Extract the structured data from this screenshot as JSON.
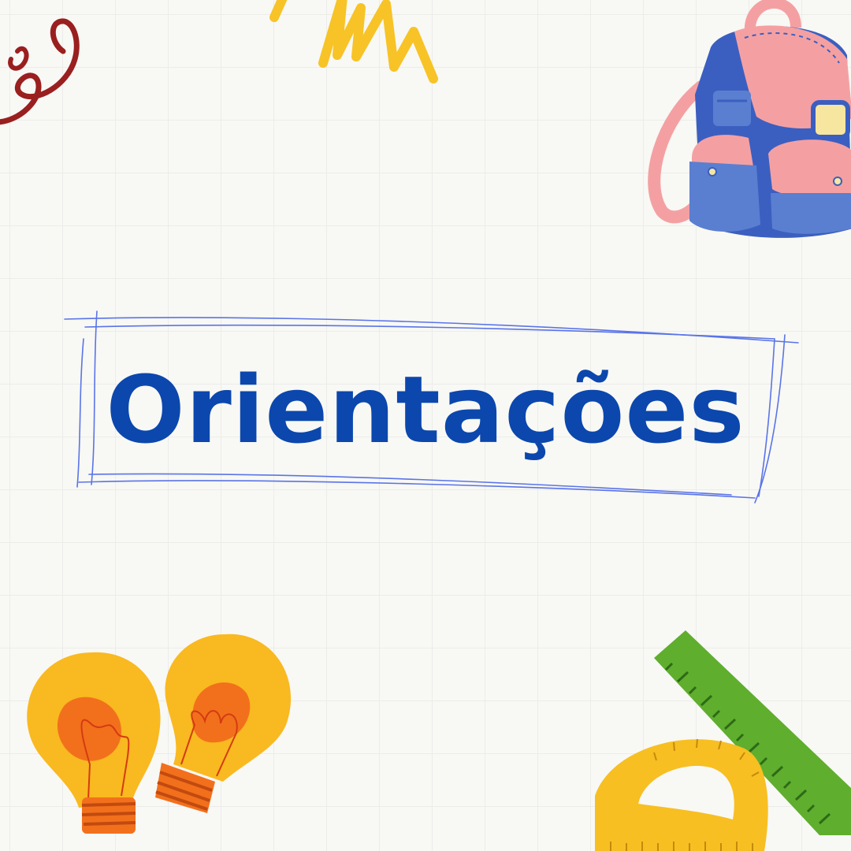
{
  "title": "Orientações",
  "colors": {
    "background": "#f8f8f5",
    "grid": "#ececea",
    "title": "#0b47ad",
    "frame": "#5a74e8",
    "scribble_red": "#9a1f1f",
    "scribble_yellow": "#f7c326",
    "backpack_blue": "#3b5fc0",
    "backpack_pink": "#f4a0a2",
    "bulb_yellow": "#f9b920",
    "bulb_orange": "#f2701c",
    "ruler_green": "#5fae2e",
    "protractor_yellow": "#f7bf22"
  },
  "icons": [
    "red-scribble-icon",
    "yellow-zigzag-icon",
    "backpack-icon",
    "lightbulb-icon",
    "lightbulb-icon",
    "ruler-icon",
    "protractor-icon"
  ]
}
